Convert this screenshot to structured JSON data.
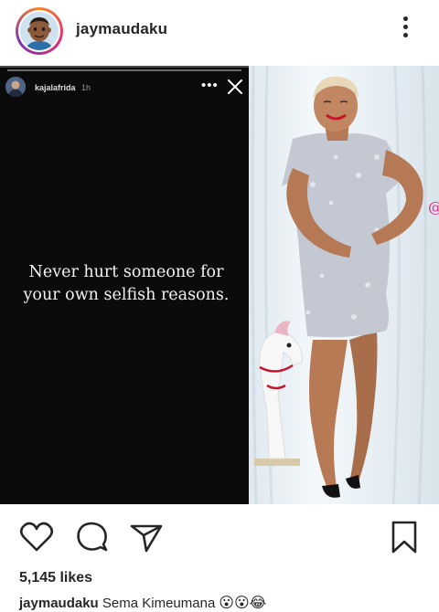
{
  "header": {
    "username": "jaymaudaku"
  },
  "story": {
    "username": "kajalafrida",
    "time": "1h",
    "quote_line1": "Never hurt someone for",
    "quote_line2": "your own selfish reasons."
  },
  "photo": {
    "watermark": "@JayMaudaku"
  },
  "actions": {
    "like_icon": "heart-icon",
    "comment_icon": "comment-icon",
    "share_icon": "share-icon",
    "save_icon": "bookmark-icon"
  },
  "likes": {
    "text": "5,145 likes"
  },
  "caption": {
    "username": "jaymaudaku",
    "text": "Sema Kimeumana",
    "emoji": "😮😮😂"
  }
}
